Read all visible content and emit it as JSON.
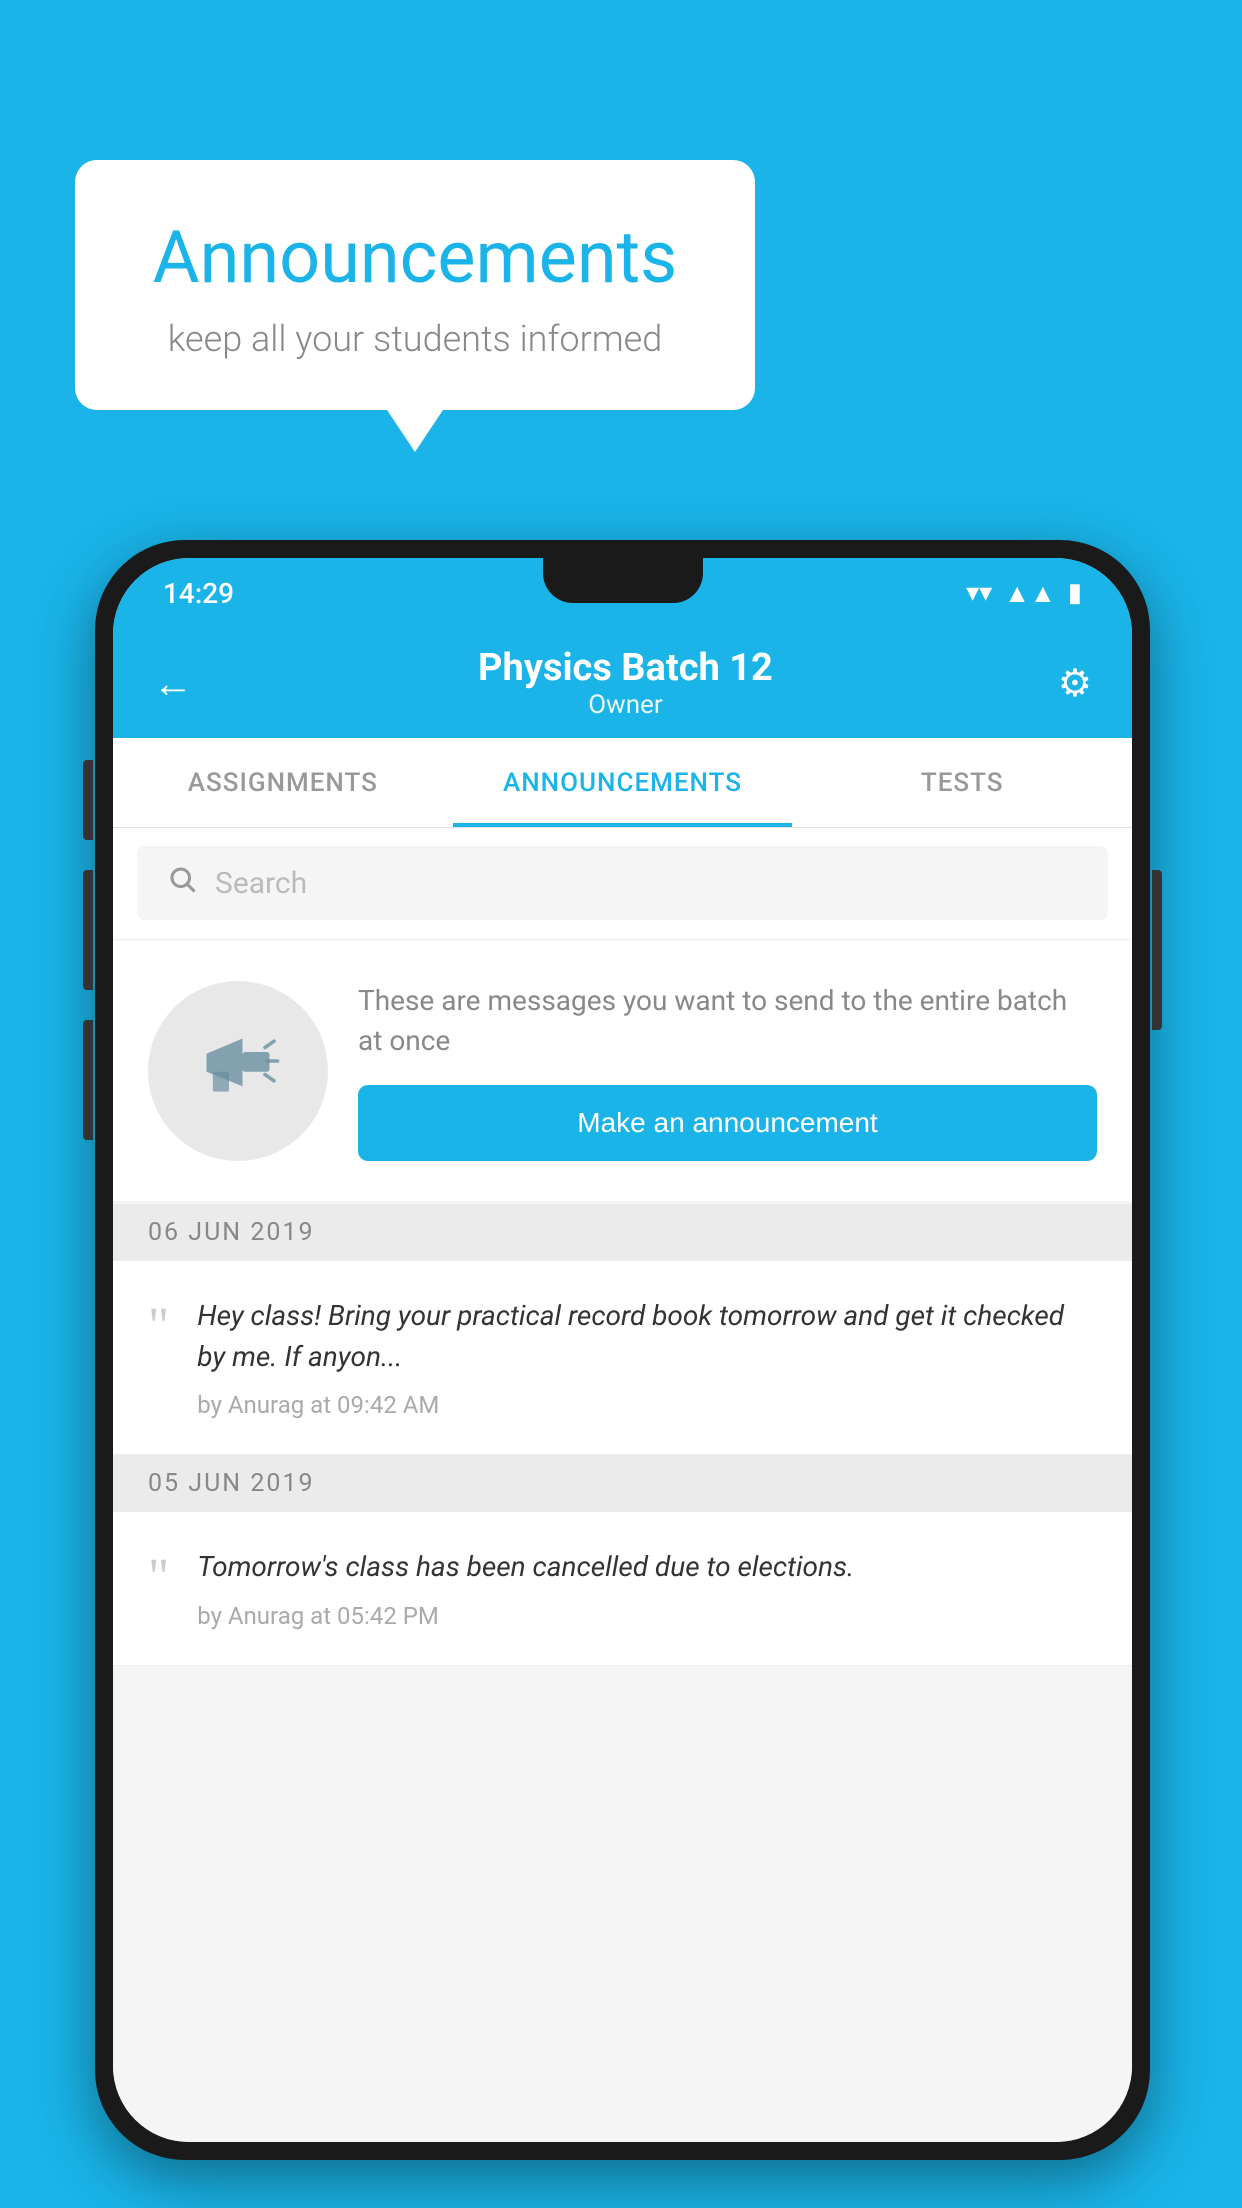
{
  "background_color": "#1ab4e8",
  "speech_bubble": {
    "title": "Announcements",
    "subtitle": "keep all your students informed"
  },
  "phone": {
    "status_bar": {
      "time": "14:29"
    },
    "app_bar": {
      "title": "Physics Batch 12",
      "subtitle": "Owner",
      "back_label": "←",
      "settings_label": "⚙"
    },
    "tabs": [
      {
        "label": "ASSIGNMENTS",
        "active": false
      },
      {
        "label": "ANNOUNCEMENTS",
        "active": true
      },
      {
        "label": "TESTS",
        "active": false
      }
    ],
    "search": {
      "placeholder": "Search"
    },
    "intro_card": {
      "description": "These are messages you want to send to the entire batch at once",
      "button_label": "Make an announcement"
    },
    "announcements": [
      {
        "date": "06  JUN  2019",
        "text": "Hey class! Bring your practical record book tomorrow and get it checked by me. If anyon...",
        "meta": "by Anurag at 09:42 AM"
      },
      {
        "date": "05  JUN  2019",
        "text": "Tomorrow's class has been cancelled due to elections.",
        "meta": "by Anurag at 05:42 PM"
      }
    ]
  }
}
